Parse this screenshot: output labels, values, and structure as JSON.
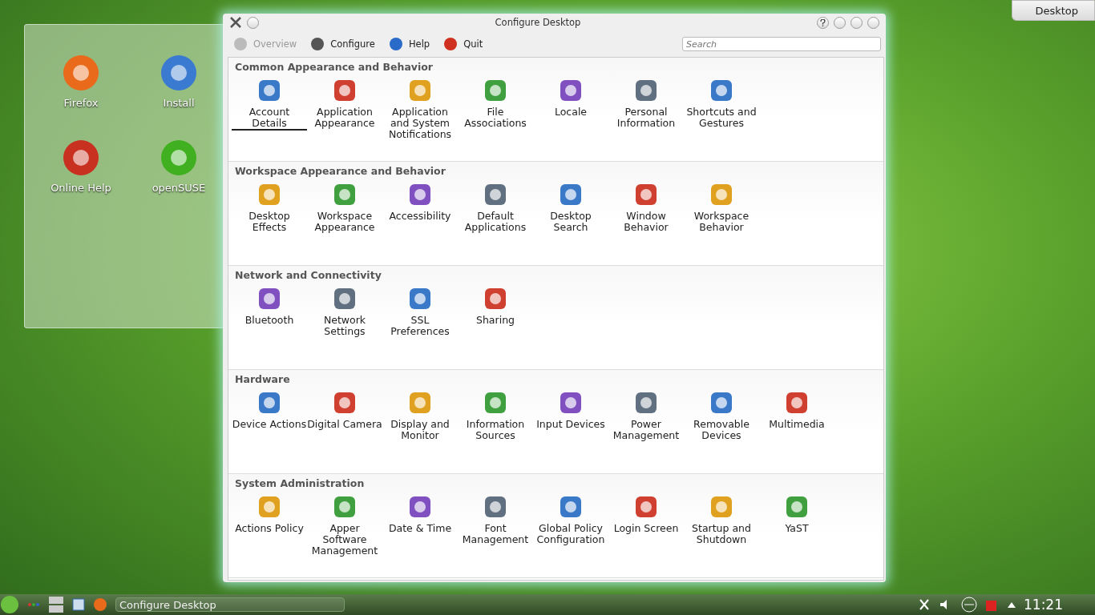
{
  "desktop_icons": [
    {
      "label": "Firefox"
    },
    {
      "label": "Install"
    },
    {
      "label": "Online Help"
    },
    {
      "label": "openSUSE"
    }
  ],
  "desktop_button": {
    "label": "Desktop"
  },
  "window": {
    "title": "Configure Desktop",
    "toolbar": [
      {
        "label": "Overview",
        "disabled": true
      },
      {
        "label": "Configure",
        "disabled": false
      },
      {
        "label": "Help",
        "disabled": false
      },
      {
        "label": "Quit",
        "disabled": false
      }
    ],
    "search": {
      "placeholder": "Search"
    },
    "sections": [
      {
        "title": "Common Appearance and Behavior",
        "items": [
          {
            "label": "Account Details",
            "hovered": true
          },
          {
            "label": "Application Appearance",
            "hovered": false
          },
          {
            "label": "Application and System Notifications",
            "hovered": false
          },
          {
            "label": "File Associations",
            "hovered": false
          },
          {
            "label": "Locale",
            "hovered": false
          },
          {
            "label": "Personal Information",
            "hovered": false
          },
          {
            "label": "Shortcuts and Gestures",
            "hovered": false
          }
        ]
      },
      {
        "title": "Workspace Appearance and Behavior",
        "items": [
          {
            "label": "Desktop Effects",
            "hovered": false
          },
          {
            "label": "Workspace Appearance",
            "hovered": false
          },
          {
            "label": "Accessibility",
            "hovered": false
          },
          {
            "label": "Default Applications",
            "hovered": false
          },
          {
            "label": "Desktop Search",
            "hovered": false
          },
          {
            "label": "Window Behavior",
            "hovered": false
          },
          {
            "label": "Workspace Behavior",
            "hovered": false
          }
        ]
      },
      {
        "title": "Network and Connectivity",
        "items": [
          {
            "label": "Bluetooth",
            "hovered": false
          },
          {
            "label": "Network Settings",
            "hovered": false
          },
          {
            "label": "SSL Preferences",
            "hovered": false
          },
          {
            "label": "Sharing",
            "hovered": false
          }
        ]
      },
      {
        "title": "Hardware",
        "items": [
          {
            "label": "Device Actions",
            "hovered": false
          },
          {
            "label": "Digital Camera",
            "hovered": false
          },
          {
            "label": "Display and Monitor",
            "hovered": false
          },
          {
            "label": "Information Sources",
            "hovered": false
          },
          {
            "label": "Input Devices",
            "hovered": false
          },
          {
            "label": "Power Management",
            "hovered": false
          },
          {
            "label": "Removable Devices",
            "hovered": false
          },
          {
            "label": "Multimedia",
            "hovered": false
          }
        ]
      },
      {
        "title": "System Administration",
        "items": [
          {
            "label": "Actions Policy",
            "hovered": false
          },
          {
            "label": "Apper Software Management",
            "hovered": false
          },
          {
            "label": "Date & Time",
            "hovered": false
          },
          {
            "label": "Font Management",
            "hovered": false
          },
          {
            "label": "Global Policy Configuration",
            "hovered": false
          },
          {
            "label": "Login Screen",
            "hovered": false
          },
          {
            "label": "Startup and Shutdown",
            "hovered": false
          },
          {
            "label": "YaST",
            "hovered": false
          }
        ]
      }
    ]
  },
  "taskbar": {
    "task": "Configure Desktop",
    "clock": "11:21"
  }
}
